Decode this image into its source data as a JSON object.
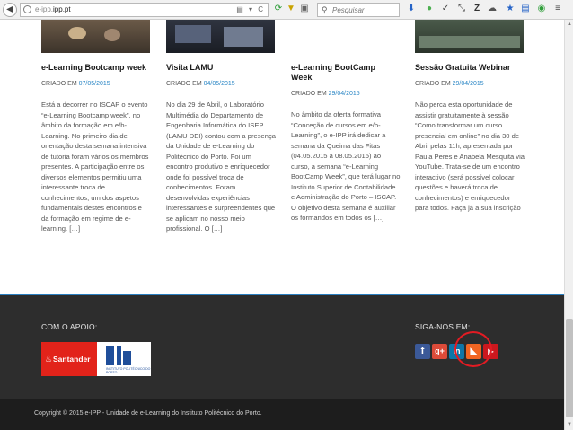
{
  "browser": {
    "url_prefix": "e-ipp.",
    "url_domain": "ipp.pt",
    "url_icons": "▤ ▾ C",
    "search_placeholder": "Pesquisar",
    "toolbar_icons": [
      "download-icon",
      "home-icon",
      "extension-icon",
      "sync-icon",
      "zotero-icon",
      "cloud-icon",
      "bookmark-star-icon",
      "reader-icon",
      "addon-icon",
      "menu-icon"
    ]
  },
  "posts": [
    {
      "title": "e-Learning Bootcamp week",
      "meta_prefix": "CRIADO EM",
      "date": "07/05/2015",
      "body": "Está a decorrer no ISCAP o evento “e-Learning Bootcamp week”, no âmbito da formação em e/b-Learning. No primeiro dia de orientação desta semana intensiva de tutoria foram vários os membros presentes. A participação entre os diversos elementos permitiu uma interessante troca de conhecimentos, um dos aspetos fundamentais destes encontros e da formação em regime de e-learning. […]"
    },
    {
      "title": "Visita LAMU",
      "meta_prefix": "CRIADO EM",
      "date": "04/05/2015",
      "body": "No dia 29 de Abril, o Laboratório Multimédia do Departamento de Engenharia Informática do ISEP (LAMU DEI) contou com a presença da Unidade de e-Learning do Politécnico do Porto. Foi um encontro produtivo e enriquecedor onde foi possível troca de conhecimentos. Foram desenvolvidas experiências interessantes e surpreendentes que se aplicam no nosso meio profissional. O […]"
    },
    {
      "title": "e-Learning BootCamp Week",
      "meta_prefix": "CRIADO EM",
      "date": "29/04/2015",
      "body": " No âmbito da oferta formativa “Conceção de cursos em e/b-Learning”, o e-IPP irá dedicar a semana da Queima das Fitas (04.05.2015 a 08.05.2015) ao curso, a semana “e-Learning BootCamp Week”, que terá lugar no Instituto Superior de Contabilidade e Administração do Porto – ISCAP. O objetivo desta semana é auxiliar os formandos em todos os […]"
    },
    {
      "title": "Sessão Gratuita Webinar",
      "meta_prefix": "CRIADO EM",
      "date": "29/04/2015",
      "body": "Não perca esta oportunidade de assistir gratuitamente à sessão “Como transformar um curso presencial em online” no dia 30 de Abril pelas 11h, apresentada por Paula Peres e Anabela Mesquita via YouTube. Trata-se de um encontro interactivo (será possível colocar questões e haverá troca de conhecimentos) e enriquecedor para todos. Faça já a sua inscrição"
    }
  ],
  "footer": {
    "support_label": "COM O APOIO:",
    "follow_label": "SIGA-NOS EM:",
    "santander": "Santander",
    "ipp_text": "INSTITUTO POLITÉCNICO DO PORTO",
    "social": [
      {
        "name": "facebook",
        "glyph": "f",
        "color": "#3b5998"
      },
      {
        "name": "google-plus",
        "glyph": "g+",
        "color": "#dd4b39"
      },
      {
        "name": "linkedin",
        "glyph": "in",
        "color": "#0e76a8"
      },
      {
        "name": "rss",
        "glyph": "◣",
        "color": "#f26522"
      },
      {
        "name": "youtube",
        "glyph": "▶",
        "color": "#cc181e"
      }
    ],
    "copyright": "Copyright © 2015 e-IPP - Unidade de e-Learning do Instituto Politécnico do Porto."
  }
}
